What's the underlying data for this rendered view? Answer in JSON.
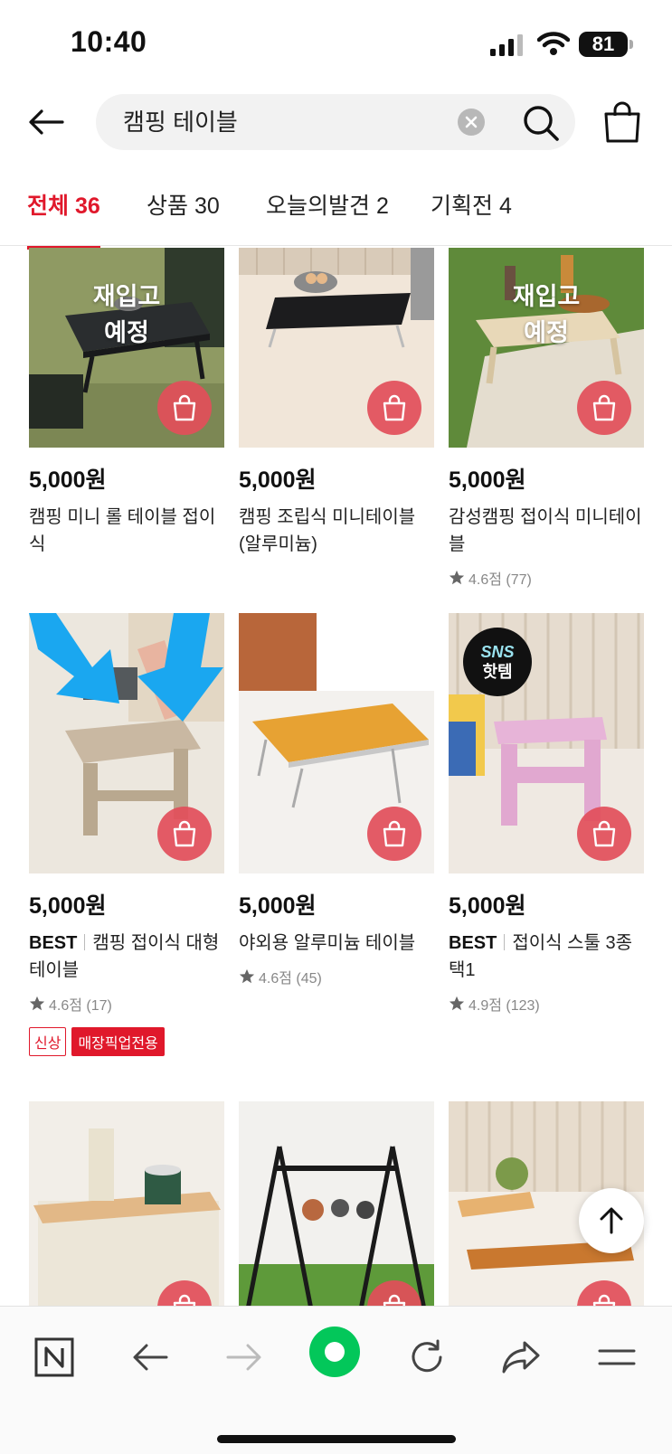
{
  "status": {
    "time": "10:40",
    "battery": "81"
  },
  "header": {
    "search_value": "캠핑 테이블"
  },
  "tabs": [
    {
      "label": "전체 36",
      "active": true
    },
    {
      "label": "상품 30"
    },
    {
      "label": "오늘의발견 2"
    },
    {
      "label": "기획전 4"
    }
  ],
  "products": [
    {
      "price": "5,000원",
      "name": "캠핑 미니 롤 테이블 접이식",
      "restock_line1": "재입고",
      "restock_line2": "예정"
    },
    {
      "price": "5,000원",
      "name": "캠핑 조립식 미니테이블(알루미늄)"
    },
    {
      "price": "5,000원",
      "name": "감성캠핑 접이식 미니테이블",
      "restock_line1": "재입고",
      "restock_line2": "예정",
      "rating": "4.6점 (77)"
    },
    {
      "price": "5,000원",
      "best": "BEST",
      "name": "캠핑 접이식 대형 테이블",
      "rating": "4.6점 (17)",
      "badge_new": "신상",
      "badge_pickup": "매장픽업전용"
    },
    {
      "price": "5,000원",
      "name": "야외용 알루미늄 테이블",
      "rating": "4.6점 (45)"
    },
    {
      "price": "5,000원",
      "best": "BEST",
      "name": "접이식 스툴 3종 택1",
      "rating": "4.9점 (123)",
      "sns_line1": "SNS",
      "sns_line2": "핫템"
    }
  ],
  "colors": {
    "accent": "#e0182b",
    "cart_circle": "#e24e5a",
    "naver_green": "#03c75a"
  }
}
